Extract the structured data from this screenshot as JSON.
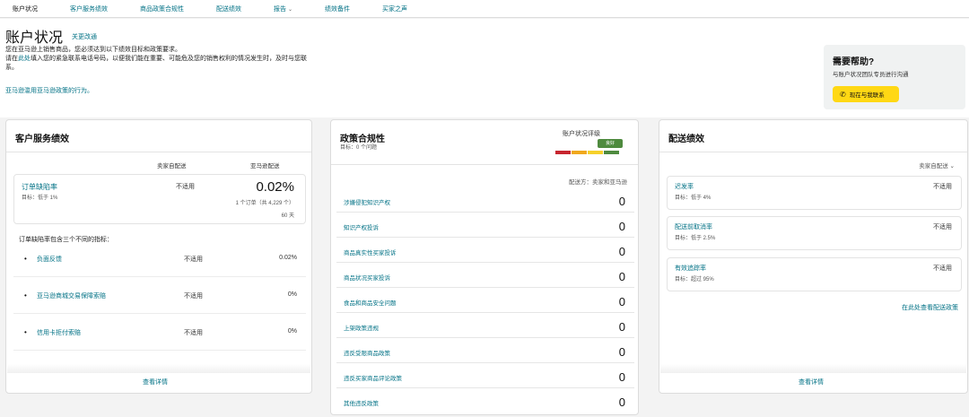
{
  "nav": {
    "tabs": [
      {
        "label": "账户状况",
        "chevron": false
      },
      {
        "label": "客户服务绩效",
        "chevron": false
      },
      {
        "label": "商品政策合规性",
        "chevron": false
      },
      {
        "label": "配送绩效",
        "chevron": false
      },
      {
        "label": "报告",
        "chevron": true
      },
      {
        "label": "绩效备件",
        "chevron": false
      },
      {
        "label": "买家之声",
        "chevron": false
      }
    ]
  },
  "header": {
    "title": "账户状况",
    "title_link": "关更改通",
    "intro1": "您在亚马逊上销售商品，您必须达到以下绩效目标和政策要求。",
    "intro2_prefix": "请在",
    "intro2_link": "此处",
    "intro2_rest": "填入您的紧急联系电话号码，以便我们能在重要、可能危及您的销售权利的情况发生时，及时与您联系。",
    "intro3": "亚马逊滥用亚马逊政策的行为。"
  },
  "help": {
    "title": "需要帮助?",
    "subtitle": "与账户状况团队专员进行沟通",
    "button": "现在与我联系",
    "button_icon": "phone-icon",
    "button_color": "#ffd814"
  },
  "customer_service": {
    "title": "客户服务绩效",
    "col_seller": "卖家自配送",
    "col_amazon": "亚马逊配送",
    "odr": {
      "name": "订单缺陷率",
      "target": "目标：低于 1%",
      "seller_value": "不适用",
      "amazon_value": "0.02%",
      "detail": "1 个订单（共 4,229 个）",
      "days": "60 天"
    },
    "note": "订单缺陷率包含三个不同的指标：",
    "metrics": [
      {
        "name": "负面反馈",
        "seller": "不适用",
        "amazon": "0.02%"
      },
      {
        "name": "亚马逊商城交易保障索赔",
        "seller": "不适用",
        "amazon": "0%"
      },
      {
        "name": "信用卡拒付索赔",
        "seller": "不适用",
        "amazon": "0%"
      }
    ],
    "view_details": "查看详情"
  },
  "policy": {
    "title": "政策合规性",
    "target": "目标：0 个问题",
    "rating_label": "账户状况评级",
    "rating_badge": "良好",
    "meter_colors": [
      "#c7252f",
      "#f0a81c",
      "#f6d12a",
      "#4e8a3e"
    ],
    "filter": "配送方：卖家和亚马逊",
    "items": [
      {
        "name": "涉嫌侵犯知识产权",
        "value": "0"
      },
      {
        "name": "知识产权投诉",
        "value": "0"
      },
      {
        "name": "商品真实性买家投诉",
        "value": "0"
      },
      {
        "name": "商品状况买家投诉",
        "value": "0"
      },
      {
        "name": "食品和商品安全问题",
        "value": "0"
      },
      {
        "name": "上架政策违规",
        "value": "0"
      },
      {
        "name": "违反受限商品政策",
        "value": "0"
      },
      {
        "name": "违反买家商品评论政策",
        "value": "0"
      },
      {
        "name": "其他违反政策",
        "value": "0"
      }
    ]
  },
  "shipping": {
    "title": "配送绩效",
    "filter": "卖家自配送",
    "metrics": [
      {
        "name": "迟发率",
        "target": "目标：低于 4%",
        "value": "不适用"
      },
      {
        "name": "配送前取消率",
        "target": "目标：低于 2.5%",
        "value": "不适用"
      },
      {
        "name": "有效追踪率",
        "target": "目标：超过 95%",
        "value": "不适用"
      }
    ],
    "more_link": "在此处查看配送政策",
    "view_details": "查看详情"
  }
}
